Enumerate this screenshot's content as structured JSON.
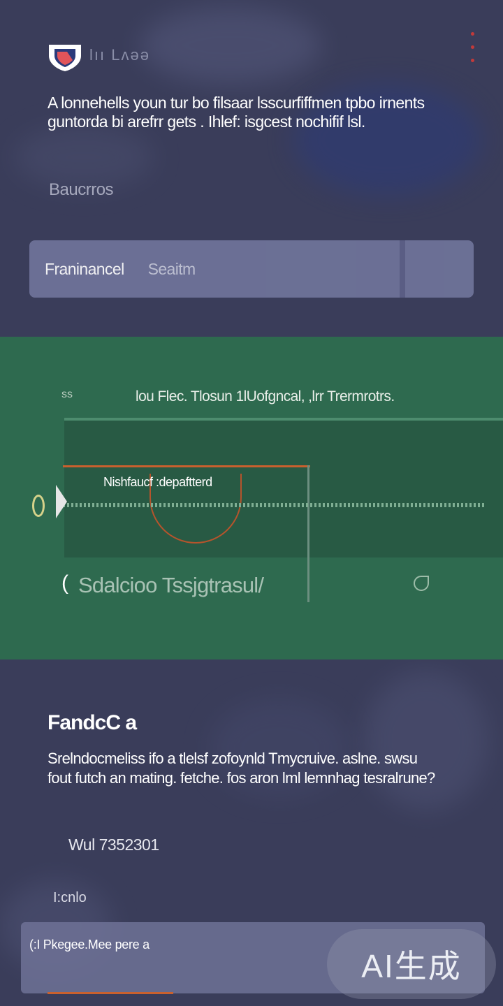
{
  "header": {
    "nav_text": "lıı Lʌəə",
    "intro": "A lonnehells youn tur bo filsaar lsscurfiffmen tpbo irnents guntorda bi arefrr gets . Ihlef: isgcest nochifif lsl."
  },
  "sections": {
    "label": "Baucrros"
  },
  "tabs": [
    {
      "label": "Franinancel"
    },
    {
      "label": "Seaitm"
    }
  ],
  "green_panel": {
    "mark": "ss",
    "caption": "lou Flec. Tlosun 1lUofgncal, ,lrr Trermrotrs.",
    "panel_label": "Nishfaucf :depaftterd",
    "stats_prefix": "(",
    "stats": "Sdalcioo Tssjgtrasul/"
  },
  "card": {
    "title": "FandcC a",
    "body": "Srelndocmeliss ifo a tlelsf zofoynld Tmycruive. aslne. swsu fout futch an mating. fetche. fos aron lml lemnhag tesralrune?",
    "meta": "Wul 7352301",
    "small_label": "I:cnlo"
  },
  "footer": {
    "text": "(:I Pkegee.Mee pere a"
  },
  "badge": {
    "text": "AI生成"
  },
  "colors": {
    "background": "#3a3d5a",
    "green": "#2e6a4f",
    "accent": "#c9602e",
    "tab_bar": "#70749a"
  },
  "icons": [
    "shield-icon",
    "menu-dots-icon",
    "ring-icon",
    "marker-arrow-icon",
    "leaf-icon"
  ]
}
